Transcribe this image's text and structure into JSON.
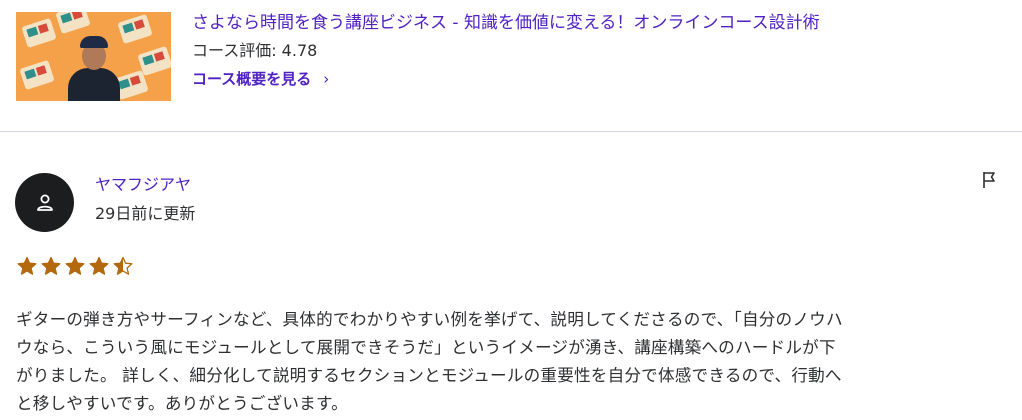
{
  "course": {
    "title": "さよなら時間を食う講座ビジネス - 知識を価値に変える！オンラインコース設計術",
    "rating_text": "コース評価: 4.78",
    "link_label": "コース概要を見る",
    "link_chevron": "›",
    "thumbnail_icon": "course-thumbnail-image"
  },
  "review": {
    "reviewer_name": "ヤマフジアヤ",
    "date_text": "29日前に更新",
    "avatar_icon": "person-icon",
    "flag_icon": "flag-icon",
    "rating": 4.5,
    "star_color": "#b4690e",
    "text_lines": [
      "ギターの弾き方やサーフィンなど、具体的でわかりやすい例を挙げて、説明してくださるので、「自分のノウハ",
      "ウなら、こういう風にモジュールとして展開できそうだ」というイメージが湧き、講座構築へのハードルが下",
      "がりました。 詳しく、細分化して説明するセクションとモジュールの重要性を自分で体感できるので、行動へ",
      "と移しやすいです。ありがとうございます。"
    ]
  },
  "colors": {
    "link": "#5022c3",
    "text": "#2d2f31",
    "divider": "#d1d7dc",
    "avatar_bg": "#1c1d1f"
  }
}
